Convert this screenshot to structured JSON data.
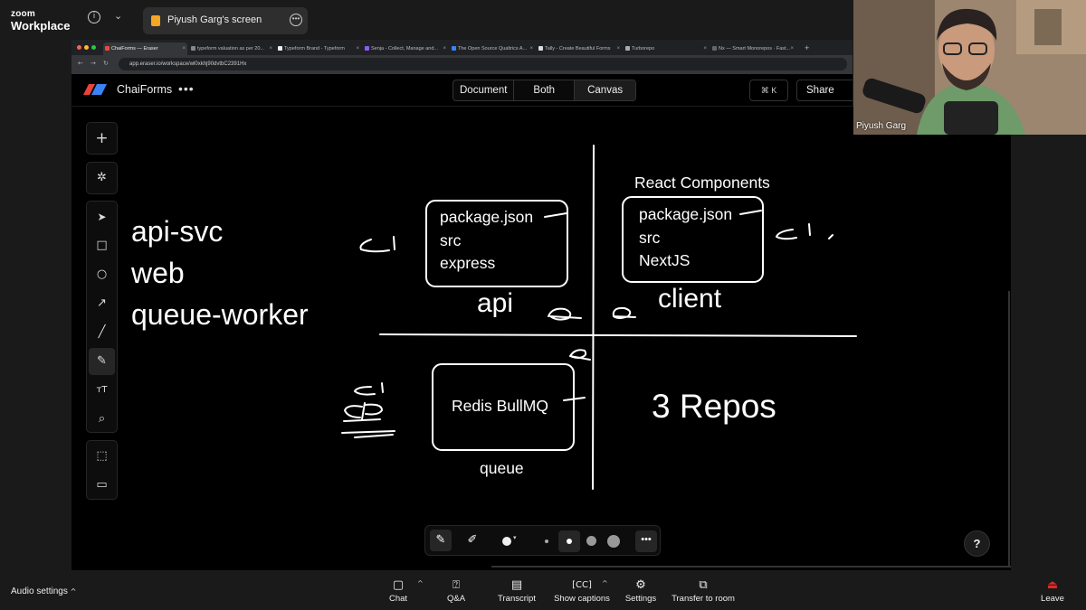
{
  "zoom": {
    "logo_line1": "zoom",
    "logo_line2": "Workplace",
    "share_title": "Piyush Garg's screen",
    "presenter_name": "Piyush Garg",
    "audio_settings": "Audio settings",
    "bottom": {
      "chat": "Chat",
      "qa": "Q&A",
      "transcript": "Transcript",
      "captions": "Show captions",
      "settings": "Settings",
      "transfer": "Transfer to room",
      "leave": "Leave"
    }
  },
  "browser": {
    "tabs": [
      "ChaiForms — Eraser",
      "typeform valuation as per 20...",
      "Typeform Brand - Typeform",
      "Senja - Collect, Manage and...",
      "The Open Source Qualtrics A...",
      "Tally - Create Beautiful Forms",
      "Turborepo",
      "Nx — Smart Monorepos · Fast..."
    ],
    "url": "app.eraser.io/workspace/wl0xkhj90dvtbC2391Hx"
  },
  "app": {
    "name": "ChaiForms",
    "more": "•••",
    "views": [
      "Document",
      "Both",
      "Canvas"
    ],
    "shortcut": "⌘ K",
    "share": "Share"
  },
  "canvas": {
    "services": [
      "api-svc",
      "web",
      "queue-worker"
    ],
    "api_box": [
      "package.json",
      "src",
      "express"
    ],
    "api_label": "api",
    "client_heading": "React Components",
    "client_box": [
      "package.json",
      "src",
      "NextJS"
    ],
    "client_label": "client",
    "queue_box": "Redis BullMQ",
    "queue_label": "queue",
    "repos": "3 Repos"
  },
  "help": "?"
}
